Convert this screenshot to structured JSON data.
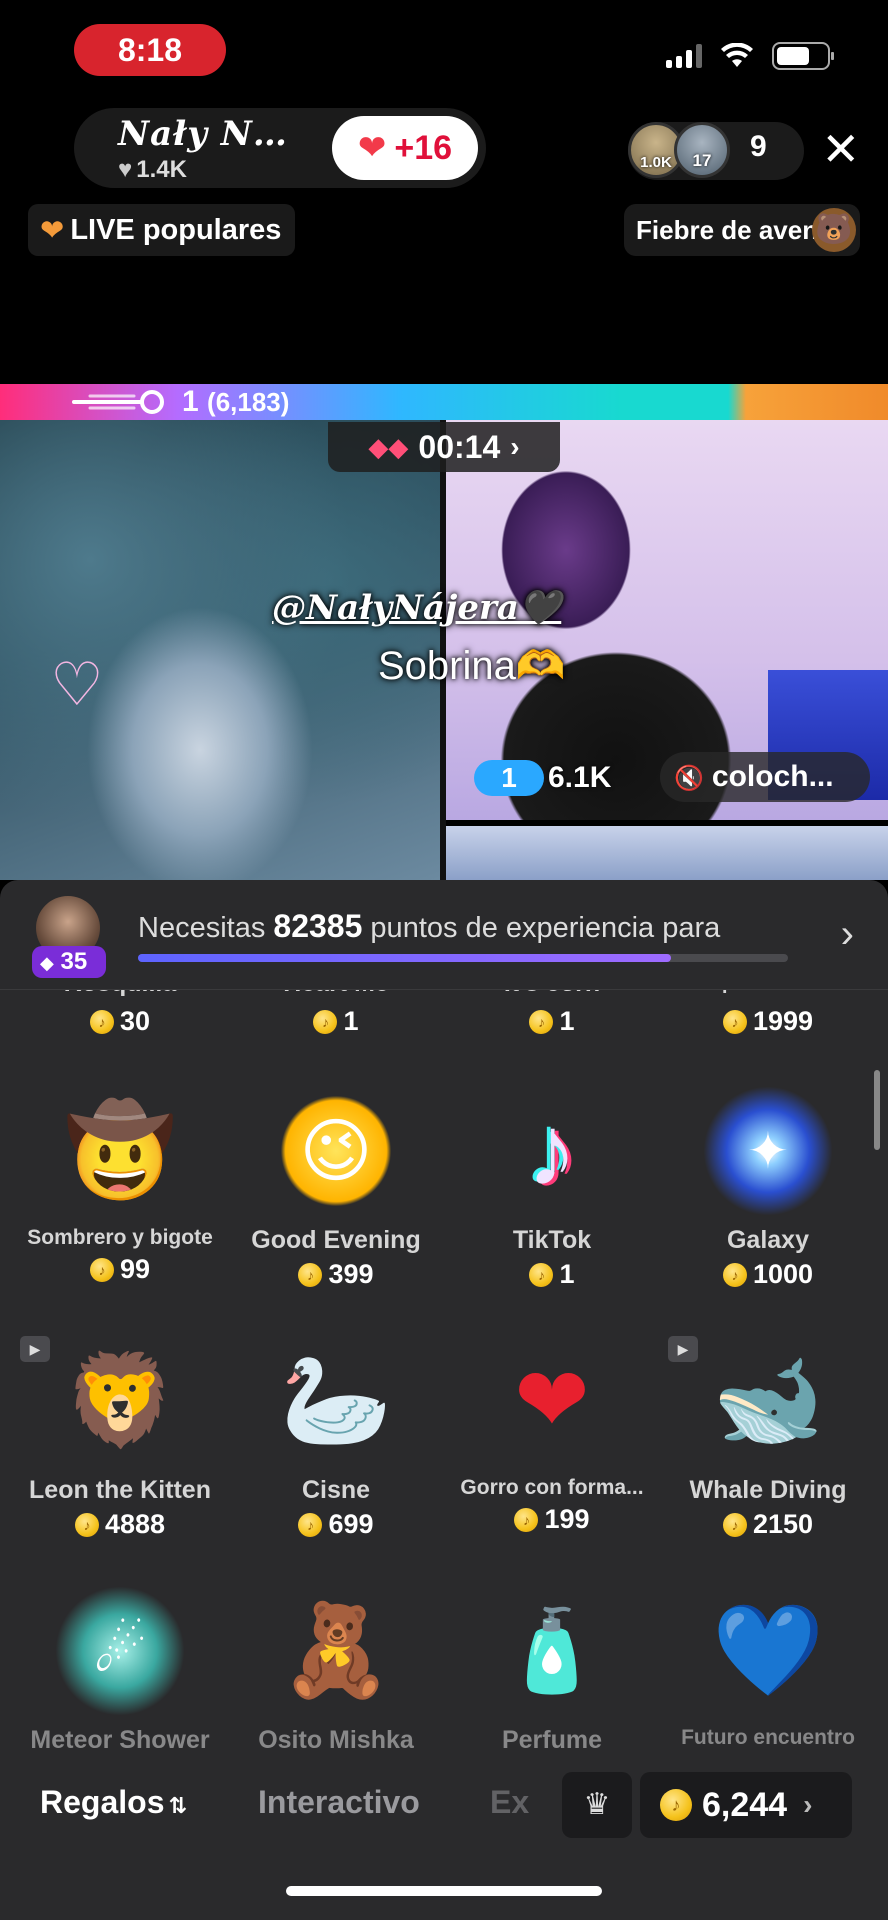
{
  "status": {
    "time": "8:18"
  },
  "header": {
    "host_name": "Nały N…",
    "host_likes": "1.4K",
    "follow_label": "+16",
    "viewer_badges": [
      "1.0K",
      "17"
    ],
    "viewer_count": "9",
    "live_popular": "LIVE populares",
    "event_label": "Fiebre de avent"
  },
  "battle": {
    "rank": "1",
    "points": "(6,183)",
    "timer": "00:14",
    "overlay_handle": "@NałyNájera🖤",
    "overlay_sub": "Sobrina🫶",
    "opponent_rank": "1",
    "opponent_score": "6.1K",
    "opponent_name": "coloch..."
  },
  "experience": {
    "level": "35",
    "prefix": "Necesitas ",
    "points": "82385",
    "suffix": " puntos de experiencia para",
    "progress": 0.82
  },
  "gifts": [
    {
      "name": "Rosquilla",
      "price": "30"
    },
    {
      "name": "Heart Me",
      "price": "1"
    },
    {
      "name": "It's corn",
      "price": "1"
    },
    {
      "name": "Búsqueda de rec…",
      "price": "1999"
    },
    {
      "name": "Sombrero y bigote",
      "price": "99",
      "icon": "sombrero-icon"
    },
    {
      "name": "Good Evening",
      "price": "399",
      "icon": "good-evening-icon"
    },
    {
      "name": "TikTok",
      "price": "1",
      "icon": "tiktok-icon"
    },
    {
      "name": "Galaxy",
      "price": "1000",
      "icon": "galaxy-icon"
    },
    {
      "name": "Leon the Kitten",
      "price": "4888",
      "icon": "lion-icon"
    },
    {
      "name": "Cisne",
      "price": "699",
      "icon": "swan-icon"
    },
    {
      "name": "Gorro con forma...",
      "price": "199",
      "icon": "heart-hat-icon"
    },
    {
      "name": "Whale Diving",
      "price": "2150",
      "icon": "whale-icon"
    },
    {
      "name": "Meteor Shower",
      "price": "",
      "icon": "meteor-icon"
    },
    {
      "name": "Osito Mishka",
      "price": "",
      "icon": "bear-icon"
    },
    {
      "name": "Perfume",
      "price": "",
      "icon": "perfume-icon"
    },
    {
      "name": "Futuro encuentro",
      "price": "",
      "icon": "future-meeting-icon"
    }
  ],
  "tabs": [
    "Regalos",
    "Interactivo",
    "Ex"
  ],
  "balance": "6,244",
  "colors": {
    "accent": "#e0103a",
    "battle_blue": "#2aa8ff",
    "level_purple": "#7a2dd8"
  }
}
